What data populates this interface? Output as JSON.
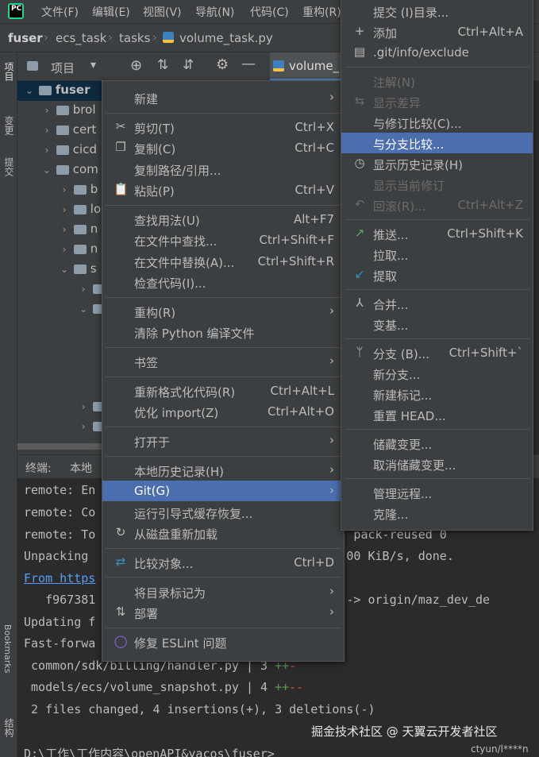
{
  "menubar": {
    "items": [
      "文件(F)",
      "编辑(E)",
      "视图(V)",
      "导航(N)",
      "代码(C)",
      "重构(R)"
    ]
  },
  "breadcrumb": [
    "fuser",
    "ecs_task",
    "tasks",
    "volume_task.py"
  ],
  "left_strip": [
    "项目",
    "变更",
    "提交",
    "Bookmarks",
    "结构"
  ],
  "project_bar": {
    "title": "项目"
  },
  "editor_tab": {
    "label": "volume_"
  },
  "tree": [
    {
      "label": "fuser",
      "bold": true
    },
    {
      "label": "brol"
    },
    {
      "label": "cert"
    },
    {
      "label": "cicd"
    },
    {
      "label": "com"
    },
    {
      "label": "b"
    },
    {
      "label": "lo"
    },
    {
      "label": "n"
    },
    {
      "label": "n"
    },
    {
      "label": "s"
    }
  ],
  "terminal": {
    "tabs": [
      "终端:",
      "本地"
    ],
    "lines": [
      "remote: En",
      "remote: Co",
      "remote: To                              a 0), pack-reused 0",
      "Unpacking                               | 20.00 KiB/s, done.",
      "From https",
      "   f967381                              1021 -> origin/maz_dev_de",
      "Updating f",
      "Fast-forwa",
      " common/sdk/billing/handler.py | 3 ++-",
      " models/ecs/volume_snapshot.py | 4 ++--",
      " 2 files changed, 4 insertions(+), 3 deletions(-)",
      "",
      "D:\\工作\\工作内容\\openAPI&yacos\\fuser>"
    ]
  },
  "context_menu": {
    "items": [
      {
        "label": "新建",
        "arrow": true
      },
      {
        "sep": true
      },
      {
        "label": "剪切(T)",
        "shortcut": "Ctrl+X",
        "icon": "scissors"
      },
      {
        "label": "复制(C)",
        "shortcut": "Ctrl+C",
        "icon": "copy"
      },
      {
        "label": "复制路径/引用..."
      },
      {
        "label": "粘贴(P)",
        "shortcut": "Ctrl+V",
        "icon": "paste"
      },
      {
        "sep": true
      },
      {
        "label": "查找用法(U)",
        "shortcut": "Alt+F7"
      },
      {
        "label": "在文件中查找...",
        "shortcut": "Ctrl+Shift+F"
      },
      {
        "label": "在文件中替换(A)...",
        "shortcut": "Ctrl+Shift+R"
      },
      {
        "label": "检查代码(I)..."
      },
      {
        "sep": true
      },
      {
        "label": "重构(R)",
        "arrow": true
      },
      {
        "label": "清除 Python 编译文件"
      },
      {
        "sep": true
      },
      {
        "label": "书签",
        "arrow": true
      },
      {
        "sep": true
      },
      {
        "label": "重新格式化代码(R)",
        "shortcut": "Ctrl+Alt+L"
      },
      {
        "label": "优化 import(Z)",
        "shortcut": "Ctrl+Alt+O"
      },
      {
        "sep": true
      },
      {
        "label": "打开于",
        "arrow": true
      },
      {
        "sep": true
      },
      {
        "label": "本地历史记录(H)",
        "arrow": true
      },
      {
        "label": "Git(G)",
        "arrow": true,
        "selected": true
      },
      {
        "label": "运行引导式缓存恢复..."
      },
      {
        "label": "从磁盘重新加载",
        "icon": "reload"
      },
      {
        "sep": true
      },
      {
        "label": "比较对象...",
        "shortcut": "Ctrl+D",
        "icon": "compare"
      },
      {
        "sep": true
      },
      {
        "label": "将目录标记为",
        "arrow": true
      },
      {
        "label": "部署",
        "arrow": true,
        "icon": "deploy"
      },
      {
        "sep": true
      },
      {
        "label": "修复 ESLint 问题",
        "icon": "eslint"
      }
    ]
  },
  "git_submenu": {
    "items": [
      {
        "label": "提交 (I)目录..."
      },
      {
        "label": "添加",
        "shortcut": "Ctrl+Alt+A",
        "icon": "plus"
      },
      {
        "label": ".git/info/exclude",
        "icon": "file"
      },
      {
        "sep": true
      },
      {
        "label": "注解(N)",
        "disabled": true
      },
      {
        "label": "显示差异",
        "disabled": true,
        "icon": "diff"
      },
      {
        "label": "与修订比较(C)..."
      },
      {
        "label": "与分支比较...",
        "selected": true
      },
      {
        "label": "显示历史记录(H)",
        "icon": "clock"
      },
      {
        "label": "显示当前修订",
        "disabled": true
      },
      {
        "label": "回滚(R)...",
        "shortcut": "Ctrl+Alt+Z",
        "disabled": true,
        "icon": "undo"
      },
      {
        "sep": true
      },
      {
        "label": "推送...",
        "shortcut": "Ctrl+Shift+K",
        "icon": "push"
      },
      {
        "label": "拉取..."
      },
      {
        "label": "提取",
        "icon": "fetch"
      },
      {
        "sep": true
      },
      {
        "label": "合并...",
        "icon": "merge"
      },
      {
        "label": "变基..."
      },
      {
        "sep": true
      },
      {
        "label": "分支 (B)...",
        "shortcut": "Ctrl+Shift+`",
        "icon": "branch"
      },
      {
        "label": "新分支..."
      },
      {
        "label": "新建标记..."
      },
      {
        "label": "重置 HEAD..."
      },
      {
        "sep": true
      },
      {
        "label": "储藏变更..."
      },
      {
        "label": "取消储藏变更..."
      },
      {
        "sep": true
      },
      {
        "label": "管理远程..."
      },
      {
        "label": "克隆..."
      }
    ]
  },
  "watermark": "掘金技术社区 @ 天翼云开发者社区",
  "watermark2": "ctyun/l****n",
  "colors": {
    "selection": "#4b6eaf",
    "menu_bg": "#3c3f41",
    "terminal_bg": "#2b2b2b",
    "diff_plus": "#629755",
    "diff_minus": "#c75450"
  }
}
